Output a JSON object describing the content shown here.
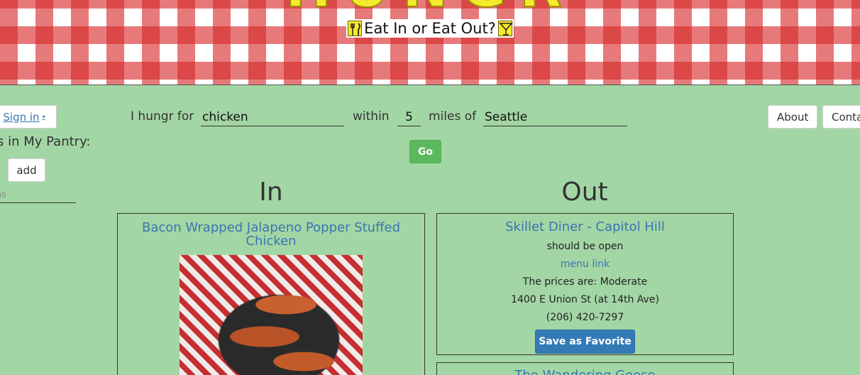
{
  "header": {
    "brand": "HUNGR",
    "tagline": "Eat In or Eat Out?",
    "left_icon": "fork-knife-icon",
    "right_icon": "cocktail-glass-icon"
  },
  "account": {
    "signin_label": "Sign in",
    "caret": "▾"
  },
  "pantry": {
    "title": "s in My Pantry:",
    "add_label": "add",
    "input_placeholder": "ns"
  },
  "search": {
    "prefix_label": "I hungr for",
    "query_value": "chicken",
    "within_label": "within",
    "distance_value": "5",
    "miles_label": "miles of",
    "location_value": "Seattle",
    "go_label": "Go"
  },
  "nav": {
    "about_label": "About",
    "contact_label": "Conta"
  },
  "columns": {
    "in_heading": "In",
    "out_heading": "Out"
  },
  "recipes": [
    {
      "title": "Bacon Wrapped Jalapeno Popper Stuffed Chicken"
    }
  ],
  "restaurants": [
    {
      "name": "Skillet Diner - Capitol Hill",
      "status": "should be open",
      "menu_link": "menu link",
      "price": "The prices are: Moderate",
      "address": "1400 E Union St (at 14th Ave)",
      "phone": "(206) 420-7297",
      "favorite_label": "Save as Favorite"
    },
    {
      "name": "The Wandering Goose"
    }
  ],
  "colors": {
    "background": "#a3d6a5",
    "gingham_red": "#d62828",
    "brand_yellow": "#f6ea2c",
    "link_blue": "#3a76b0",
    "go_green": "#5cb85c",
    "favorite_blue": "#337ab7"
  }
}
